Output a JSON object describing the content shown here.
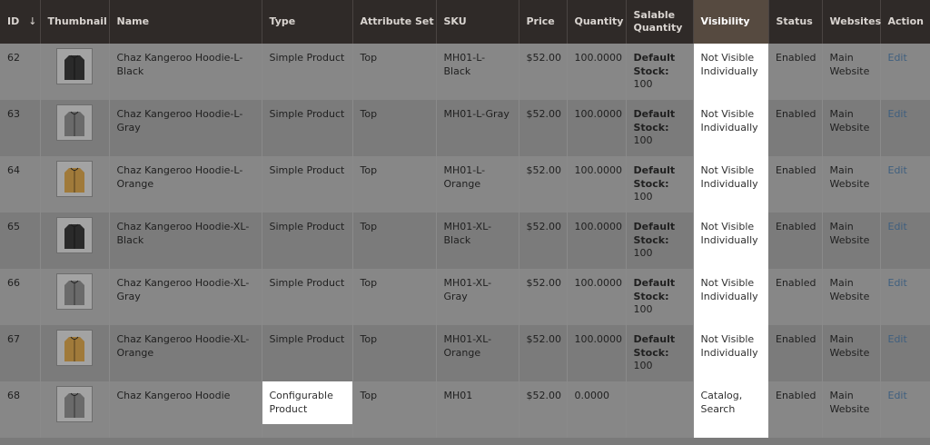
{
  "headers": {
    "id": "ID",
    "sort_indicator": "↓",
    "thumbnail": "Thumbnail",
    "name": "Name",
    "type": "Type",
    "attribute_set": "Attribute Set",
    "sku": "SKU",
    "price": "Price",
    "quantity": "Quantity",
    "salable_quantity_line1": "Salable",
    "salable_quantity_line2": "Quantity",
    "visibility": "Visibility",
    "status": "Status",
    "websites": "Websites",
    "action": "Action"
  },
  "salable_label": "Default Stock",
  "colors": {
    "header_bg": "#2f2a28",
    "visibility_header_bg": "#564a40",
    "highlight": "#ffffff",
    "link": "#3f5f7f"
  },
  "rows": [
    {
      "id": "62",
      "name_l1": "Chaz Kangeroo Hoodie-L-",
      "name_l2": "Black",
      "type_l1": "Simple Product",
      "type_l2": "",
      "attribute_set": "Top",
      "sku_l1": "MH01-L-Black",
      "sku_l2": "",
      "price": "$52.00",
      "quantity": "100.0000",
      "salable_value": "100",
      "visibility_l1": "Not Visible",
      "visibility_l2": "Individually",
      "status": "Enabled",
      "websites_l1": "Main",
      "websites_l2": "Website",
      "action": "Edit",
      "thumb_color": "#2a2a2a"
    },
    {
      "id": "63",
      "name_l1": "Chaz Kangeroo Hoodie-L-",
      "name_l2": "Gray",
      "type_l1": "Simple Product",
      "type_l2": "",
      "attribute_set": "Top",
      "sku_l1": "MH01-L-Gray",
      "sku_l2": "",
      "price": "$52.00",
      "quantity": "100.0000",
      "salable_value": "100",
      "visibility_l1": "Not Visible",
      "visibility_l2": "Individually",
      "status": "Enabled",
      "websites_l1": "Main",
      "websites_l2": "Website",
      "action": "Edit",
      "thumb_color": "#6a6a6a"
    },
    {
      "id": "64",
      "name_l1": "Chaz Kangeroo Hoodie-L-",
      "name_l2": "Orange",
      "type_l1": "Simple Product",
      "type_l2": "",
      "attribute_set": "Top",
      "sku_l1": "MH01-L-",
      "sku_l2": "Orange",
      "price": "$52.00",
      "quantity": "100.0000",
      "salable_value": "100",
      "visibility_l1": "Not Visible",
      "visibility_l2": "Individually",
      "status": "Enabled",
      "websites_l1": "Main",
      "websites_l2": "Website",
      "action": "Edit",
      "thumb_color": "#a07a3a"
    },
    {
      "id": "65",
      "name_l1": "Chaz Kangeroo Hoodie-XL-",
      "name_l2": "Black",
      "type_l1": "Simple Product",
      "type_l2": "",
      "attribute_set": "Top",
      "sku_l1": "MH01-XL-",
      "sku_l2": "Black",
      "price": "$52.00",
      "quantity": "100.0000",
      "salable_value": "100",
      "visibility_l1": "Not Visible",
      "visibility_l2": "Individually",
      "status": "Enabled",
      "websites_l1": "Main",
      "websites_l2": "Website",
      "action": "Edit",
      "thumb_color": "#2a2a2a"
    },
    {
      "id": "66",
      "name_l1": "Chaz Kangeroo Hoodie-XL-",
      "name_l2": "Gray",
      "type_l1": "Simple Product",
      "type_l2": "",
      "attribute_set": "Top",
      "sku_l1": "MH01-XL-Gray",
      "sku_l2": "",
      "price": "$52.00",
      "quantity": "100.0000",
      "salable_value": "100",
      "visibility_l1": "Not Visible",
      "visibility_l2": "Individually",
      "status": "Enabled",
      "websites_l1": "Main",
      "websites_l2": "Website",
      "action": "Edit",
      "thumb_color": "#6a6a6a"
    },
    {
      "id": "67",
      "name_l1": "Chaz Kangeroo Hoodie-XL-",
      "name_l2": "Orange",
      "type_l1": "Simple Product",
      "type_l2": "",
      "attribute_set": "Top",
      "sku_l1": "MH01-XL-",
      "sku_l2": "Orange",
      "price": "$52.00",
      "quantity": "100.0000",
      "salable_value": "100",
      "visibility_l1": "Not Visible",
      "visibility_l2": "Individually",
      "status": "Enabled",
      "websites_l1": "Main",
      "websites_l2": "Website",
      "action": "Edit",
      "thumb_color": "#a07a3a"
    },
    {
      "id": "68",
      "name_l1": "Chaz Kangeroo Hoodie",
      "name_l2": "",
      "type_l1": "Configurable",
      "type_l2": "Product",
      "attribute_set": "Top",
      "sku_l1": "MH01",
      "sku_l2": "",
      "price": "$52.00",
      "quantity": "0.0000",
      "salable_value": "",
      "visibility_l1": "Catalog,",
      "visibility_l2": "Search",
      "status": "Enabled",
      "websites_l1": "Main",
      "websites_l2": "Website",
      "action": "Edit",
      "thumb_color": "#6a6a6a"
    }
  ]
}
